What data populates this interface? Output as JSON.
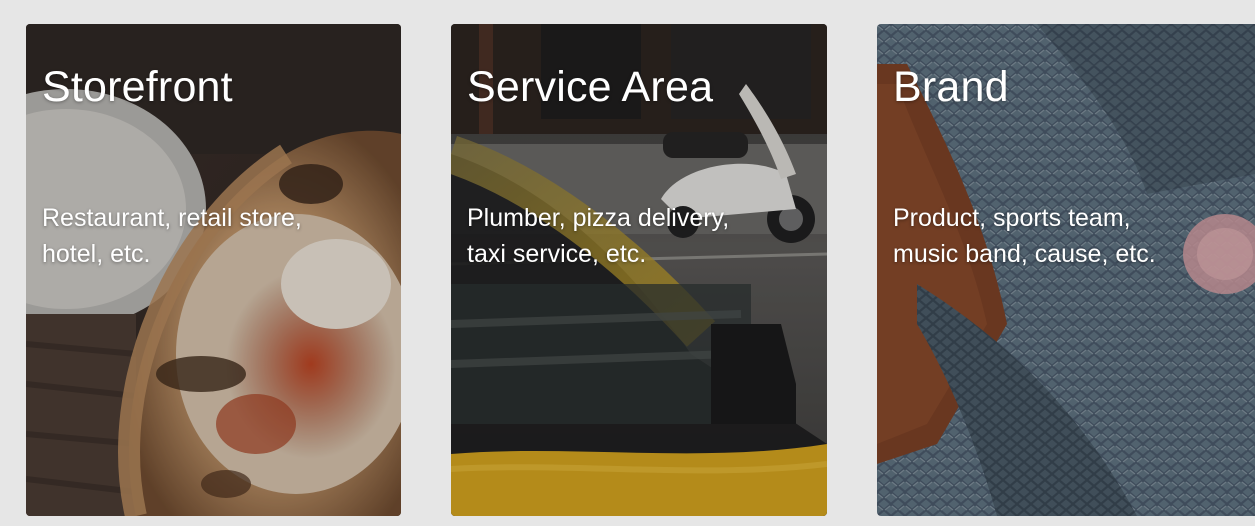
{
  "cards": [
    {
      "title": "Storefront",
      "description_lines": [
        "Restaurant, retail store,",
        "hotel, etc."
      ]
    },
    {
      "title": "Service Area",
      "description_lines": [
        "Plumber, pizza delivery,",
        "taxi service, etc."
      ]
    },
    {
      "title": "Brand",
      "description_lines": [
        "Product, sports team,",
        "music band, cause, etc."
      ]
    }
  ],
  "colors": {
    "page_background": "#e6e6e6",
    "card_text": "#ffffff"
  }
}
